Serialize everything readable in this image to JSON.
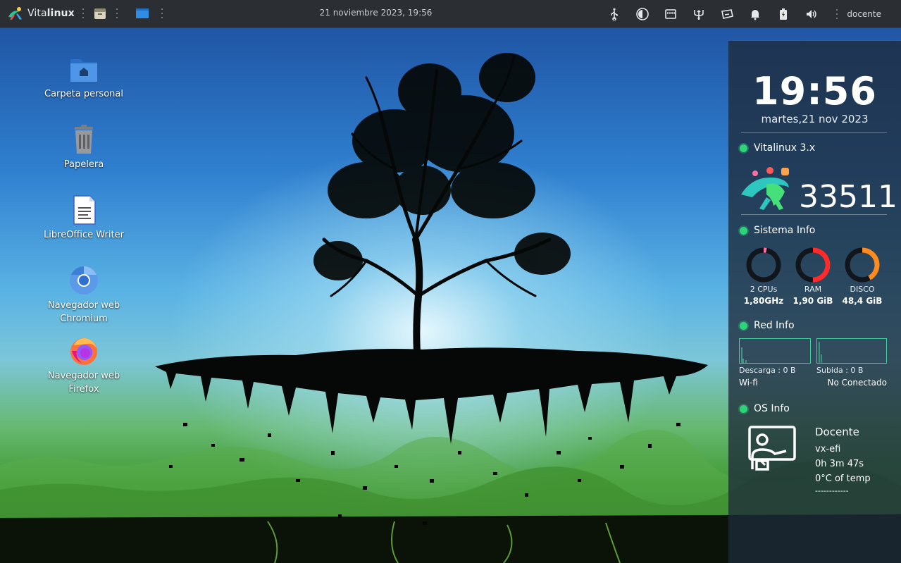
{
  "topbar": {
    "brand_prefix": "Vita",
    "brand_suffix": "linux",
    "datetime": "21 noviembre 2023, 19:56",
    "user": "docente",
    "launchers": [
      "file-manager-icon",
      "window-icon"
    ],
    "tray_icons": [
      "usb-icon",
      "night-light-icon",
      "network-card-icon",
      "trident-icon",
      "keyboard-icon",
      "notification-bell-icon",
      "battery-charging-icon",
      "volume-icon"
    ]
  },
  "desktop": {
    "icons": [
      {
        "label": "Carpeta personal",
        "icon": "home-folder-icon"
      },
      {
        "label": "Papelera",
        "icon": "trash-icon"
      },
      {
        "label": "LibreOffice Writer",
        "icon": "libreoffice-writer-icon"
      },
      {
        "label": "Navegador web Chromium",
        "icon": "chromium-icon"
      },
      {
        "label": "Navegador web Firefox",
        "icon": "firefox-icon"
      }
    ]
  },
  "conky": {
    "time": "19:56",
    "date": "martes,21 nov 2023",
    "distro": {
      "title": "Vitalinux 3.x",
      "id": "33511"
    },
    "system": {
      "title": "Sistema Info",
      "gauges": [
        {
          "label": "2 CPUs",
          "value": "1,80GHz",
          "fraction": 0.03,
          "color": "#ff6fa8"
        },
        {
          "label": "RAM",
          "value": "1,90 GiB",
          "fraction": 0.5,
          "color": "#ff2a2a"
        },
        {
          "label": "DISCO",
          "value": "48,4 GiB",
          "fraction": 0.42,
          "color": "#ff8a1e"
        }
      ]
    },
    "network": {
      "title": "Red Info",
      "download": "Descarga : 0 B",
      "upload": "Subida : 0 B",
      "iface": "Wi-fi",
      "status": "No Conectado"
    },
    "os": {
      "title": "OS Info",
      "user": "Docente",
      "host": "vx-efi",
      "uptime": "0h 3m 47s",
      "temp": "0°C of temp",
      "footer": "------------"
    }
  }
}
